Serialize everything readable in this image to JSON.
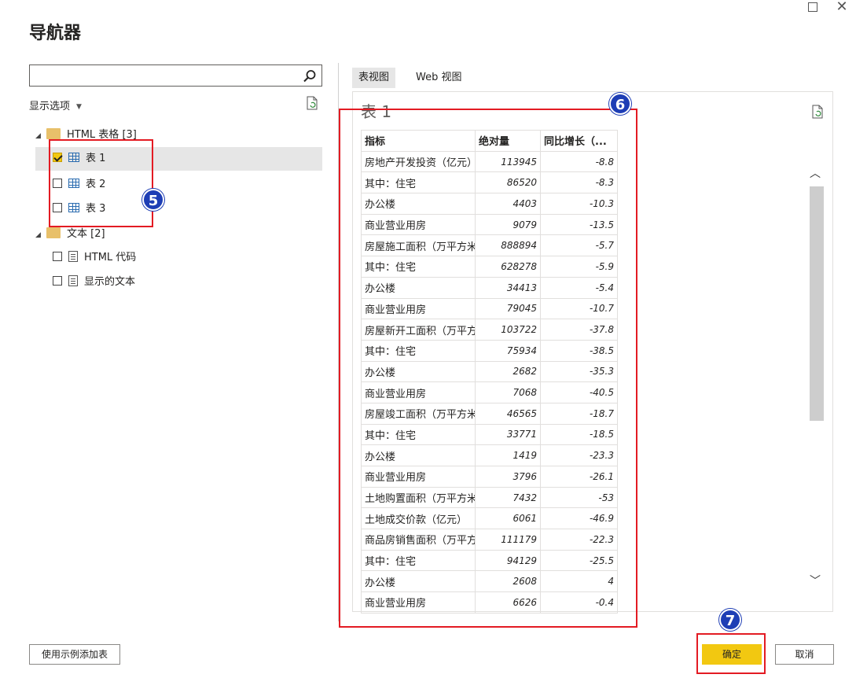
{
  "title": "导航器",
  "search": {
    "value": "",
    "placeholder": ""
  },
  "display_options": "显示选项",
  "tree": {
    "html_group": "HTML 表格 [3]",
    "tables": [
      "表 1",
      "表 2",
      "表 3"
    ],
    "text_group": "文本 [2]",
    "texts": [
      "HTML 代码",
      "显示的文本"
    ]
  },
  "tabs": [
    "表视图",
    "Web 视图"
  ],
  "preview": {
    "title": "表 1",
    "columns": [
      "指标",
      "绝对量",
      "同比增长（..."
    ],
    "rows": [
      [
        "房地产开发投资（亿元）",
        "113945",
        "-8.8"
      ],
      [
        "其中：住宅",
        "86520",
        "-8.3"
      ],
      [
        "办公楼",
        "4403",
        "-10.3"
      ],
      [
        "商业营业用房",
        "9079",
        "-13.5"
      ],
      [
        "房屋施工面积（万平方米）",
        "888894",
        "-5.7"
      ],
      [
        "其中：住宅",
        "628278",
        "-5.9"
      ],
      [
        "办公楼",
        "34413",
        "-5.4"
      ],
      [
        "商业营业用房",
        "79045",
        "-10.7"
      ],
      [
        "房屋新开工面积（万平方米）",
        "103722",
        "-37.8"
      ],
      [
        "其中：住宅",
        "75934",
        "-38.5"
      ],
      [
        "办公楼",
        "2682",
        "-35.3"
      ],
      [
        "商业营业用房",
        "7068",
        "-40.5"
      ],
      [
        "房屋竣工面积（万平方米）",
        "46565",
        "-18.7"
      ],
      [
        "其中：住宅",
        "33771",
        "-18.5"
      ],
      [
        "办公楼",
        "1419",
        "-23.3"
      ],
      [
        "商业营业用房",
        "3796",
        "-26.1"
      ],
      [
        "土地购置面积（万平方米）",
        "7432",
        "-53"
      ],
      [
        "土地成交价款（亿元）",
        "6061",
        "-46.9"
      ],
      [
        "商品房销售面积（万平方米）",
        "111179",
        "-22.3"
      ],
      [
        "其中：住宅",
        "94129",
        "-25.5"
      ],
      [
        "办公楼",
        "2608",
        "4"
      ],
      [
        "商业营业用房",
        "6626",
        "-0.4"
      ]
    ]
  },
  "badges": [
    "5",
    "6",
    "7"
  ],
  "buttons": {
    "add_by_example": "使用示例添加表",
    "ok": "确定",
    "cancel": "取消"
  },
  "colors": {
    "accent": "#f2c811",
    "badge": "#1e3eb5",
    "highlight": "#e31b23"
  }
}
